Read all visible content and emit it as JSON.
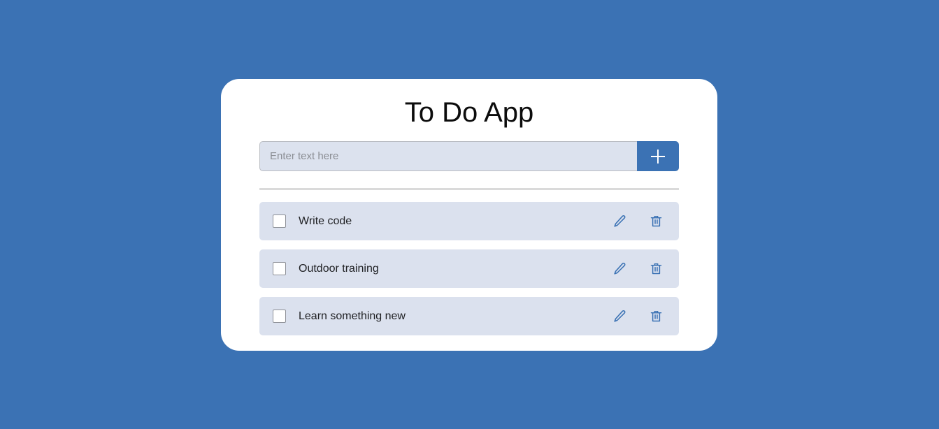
{
  "app": {
    "title": "To Do App",
    "background_color": "#3b72b4",
    "card_color": "#ffffff"
  },
  "compose": {
    "input_value": "",
    "input_placeholder": "Enter text here",
    "add_button_label": "+",
    "add_button_icon": "plus-icon",
    "add_button_color": "#3b72b4",
    "input_background": "#dce2ee"
  },
  "tasks": {
    "row_background": "#dbe1ee",
    "icon_color": "#3b72b4",
    "items": [
      {
        "label": "Write code",
        "checked": false,
        "edit_icon": "pencil-icon",
        "delete_icon": "trash-icon"
      },
      {
        "label": "Outdoor training",
        "checked": false,
        "edit_icon": "pencil-icon",
        "delete_icon": "trash-icon"
      },
      {
        "label": "Learn something new",
        "checked": false,
        "edit_icon": "pencil-icon",
        "delete_icon": "trash-icon"
      }
    ]
  }
}
